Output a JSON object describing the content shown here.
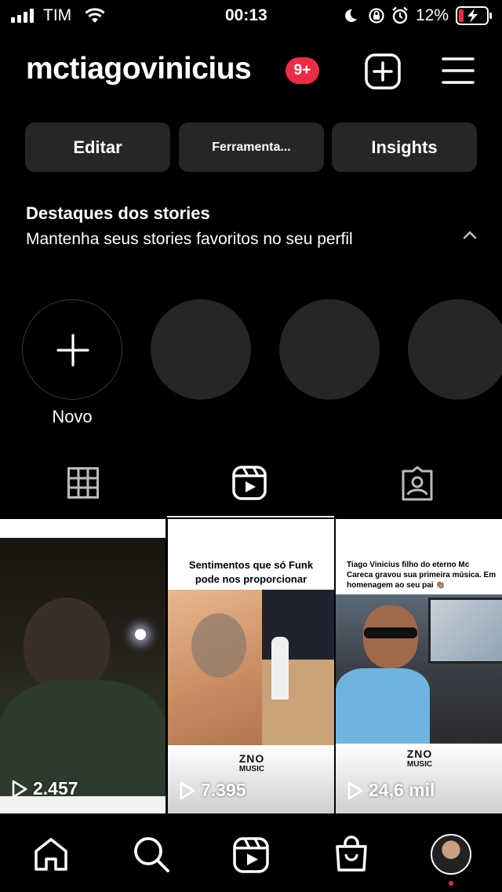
{
  "status_bar": {
    "carrier": "TIM",
    "time": "00:13",
    "battery": "12%"
  },
  "profile": {
    "username": "mctiagovinicius",
    "notifications_badge": "9+"
  },
  "buttons": {
    "edit": "Editar",
    "tools": "Ferramenta...",
    "insights": "Insights"
  },
  "highlights": {
    "title": "Destaques dos stories",
    "description": "Mantenha seus stories favoritos no seu perfil",
    "new_label": "Novo"
  },
  "tabs": {
    "grid": "grid-icon",
    "reels": "reels-icon",
    "tagged": "tagged-icon",
    "active": "reels"
  },
  "reels": [
    {
      "views": "2.457",
      "caption": "",
      "logo": ""
    },
    {
      "views": "7.395",
      "caption": "Sentimentos que só Funk pode nos proporcionar",
      "logo": "ZNO MUSIC"
    },
    {
      "views": "24,6 mil",
      "caption": "Tiago Vinicius filho do eterno Mc Careca gravou sua primeira música. Em homenagem ao seu pai 👏🏽",
      "logo": "ZNO MUSIC"
    }
  ],
  "colors": {
    "badge": "#ed2d45",
    "button_bg": "#262626",
    "background": "#000000"
  }
}
